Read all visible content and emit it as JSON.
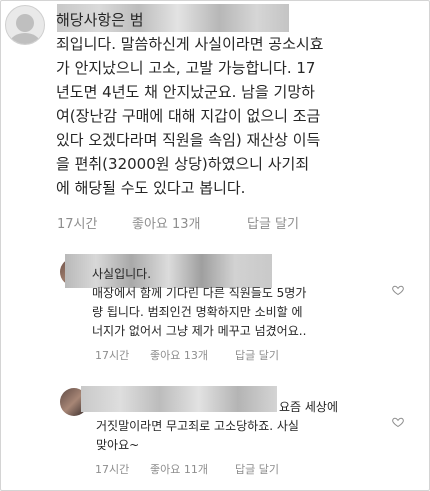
{
  "main_comment": {
    "text": "해당사항은 범\n죄입니다. 말씀하신게 사실이라면 공소시효\n가 안지났으니 고소, 고발 가능합니다. 17\n년도면 4년도 채 안지났군요. 남을 기망하\n여(장난감 구매에 대해 지갑이 없으니 조금\n있다 오겠다라며 직원을 속임) 재산상 이득\n을 편취(32000원 상당)하였으니 사기죄\n에 해당될 수도 있다고 봅니다.",
    "time": "17시간",
    "likes": "좋아요 13개",
    "reply_label": "답글 달기"
  },
  "replies": [
    {
      "text": "사실입니다.\n매장에서 함께 기다린 다른 직원들도 5명가\n량 됩니다. 범죄인건 명확하지만 소비할 에\n너지가 없어서 그냥 제가 메꾸고 넘겼어요..",
      "time": "17시간",
      "likes": "좋아요 13개",
      "reply_label": "답글 달기"
    },
    {
      "text": "요즘 세상에\n거짓말이라면 무고죄로 고소당하죠. 사실\n맞아요~",
      "time": "17시간",
      "likes": "좋아요 11개",
      "reply_label": "답글 달기"
    }
  ],
  "icons": {
    "like": "heart-outline-icon",
    "avatar": "default-avatar-icon"
  },
  "colors": {
    "text": "#262626",
    "meta": "#8e8e8e",
    "border": "#d4d4d4"
  }
}
